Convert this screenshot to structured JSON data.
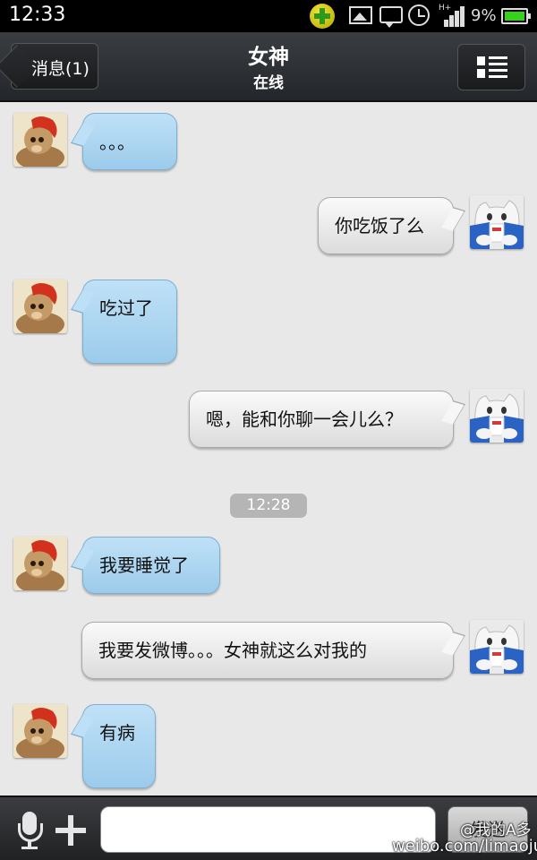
{
  "status_bar": {
    "time": "12:33",
    "battery_percent": "9%",
    "battery_color": "#35d21b",
    "icons": [
      "app-plus-icon",
      "photo-icon",
      "message-icon",
      "alarm-icon",
      "signal-icon",
      "battery-icon"
    ]
  },
  "header": {
    "back_label": "消息(1)",
    "title": "女神",
    "subtitle": "在线",
    "menu_icon": "list-menu-icon"
  },
  "messages": [
    {
      "side": "left",
      "text": "。。。"
    },
    {
      "side": "right",
      "text": "你吃饭了么"
    },
    {
      "side": "left",
      "text": "吃过了"
    },
    {
      "side": "right",
      "text": "嗯，能和你聊一会儿么？"
    },
    {
      "type": "time",
      "text": "12:28"
    },
    {
      "side": "left",
      "text": "我要睡觉了"
    },
    {
      "side": "right",
      "text": "我要发微博。。。女神就这么对我的"
    },
    {
      "side": "left",
      "text": "有病"
    }
  ],
  "input_bar": {
    "value": "",
    "send_label": "发送"
  },
  "watermark": {
    "line1": "@我的A多",
    "line2": "weibo.com/limaojun"
  },
  "colors": {
    "incoming_bubble": "#a9d3ef",
    "outgoing_bubble": "#ececec",
    "background": "#e8e8e8"
  }
}
